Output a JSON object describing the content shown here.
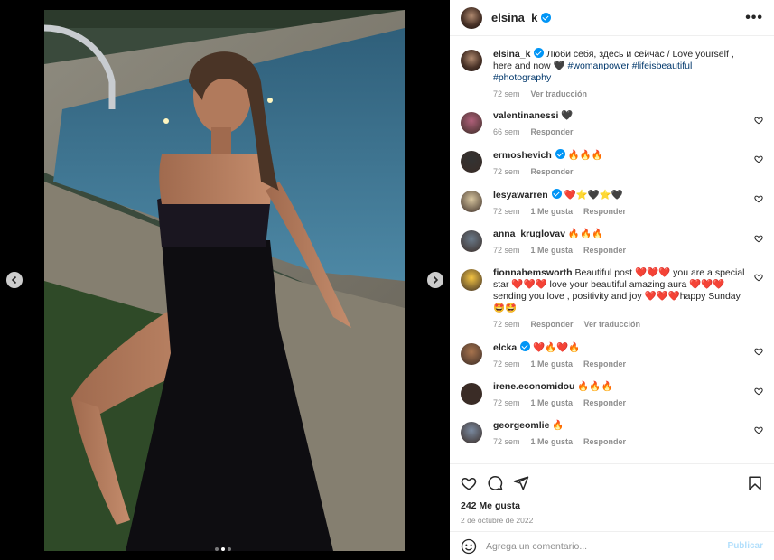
{
  "post": {
    "username": "elsina_k",
    "more_label": "•••",
    "caption_user": "elsina_k",
    "caption_text": "Люби себя, здесь и сейчас / Love yourself , here and now 🖤 ",
    "caption_tags": "#womanpower #lifeisbeautiful #photography",
    "caption_time": "72 sem",
    "caption_translate": "Ver traducción",
    "likes": "242 Me gusta",
    "date": "2 de octubre de 2022"
  },
  "comments": [
    {
      "user": "valentinanessi",
      "text": "🖤",
      "time": "66 sem",
      "likes": "",
      "reply": "Responder",
      "translate": "",
      "verified": false,
      "color": "#b0607a"
    },
    {
      "user": "ermoshevich",
      "text": "🔥🔥🔥",
      "time": "72 sem",
      "likes": "",
      "reply": "Responder",
      "translate": "",
      "verified": true,
      "color": "#333333"
    },
    {
      "user": "lesyawarren",
      "text": "❤️⭐🖤⭐🖤",
      "time": "72 sem",
      "likes": "1 Me gusta",
      "reply": "Responder",
      "translate": "",
      "verified": true,
      "color": "#d9c7a0"
    },
    {
      "user": "anna_kruglovav",
      "text": "🔥🔥🔥",
      "time": "72 sem",
      "likes": "1 Me gusta",
      "reply": "Responder",
      "translate": "",
      "verified": false,
      "color": "#6a7a8a"
    },
    {
      "user": "fionnahemsworth",
      "text": "Beautiful post ❤️❤️❤️ you are a special star ❤️❤️❤️ love your beautiful amazing aura ❤️❤️❤️ sending you love , positivity and joy ❤️❤️❤️happy Sunday 🤩🤩",
      "time": "72 sem",
      "likes": "",
      "reply": "Responder",
      "translate": "Ver traducción",
      "verified": false,
      "color": "#f5c542"
    },
    {
      "user": "elcka",
      "text": "❤️🔥❤️🔥",
      "time": "72 sem",
      "likes": "1 Me gusta",
      "reply": "Responder",
      "translate": "",
      "verified": true,
      "color": "#a8744e"
    },
    {
      "user": "irene.economidou",
      "text": "🔥🔥🔥",
      "time": "72 sem",
      "likes": "1 Me gusta",
      "reply": "Responder",
      "translate": "",
      "verified": false,
      "color": "#3a2c26"
    },
    {
      "user": "georgeomlie",
      "text": "🔥",
      "time": "72 sem",
      "likes": "1 Me gusta",
      "reply": "Responder",
      "translate": "",
      "verified": false,
      "color": "#7a8aa0"
    }
  ],
  "add_comment": {
    "placeholder": "Agrega un comentario...",
    "post_label": "Publicar"
  },
  "carousel": {
    "total": 3,
    "active": 2
  },
  "icons": {
    "like": "heart-icon",
    "comment": "comment-icon",
    "share": "share-icon",
    "save": "bookmark-icon",
    "emoji": "emoji-icon",
    "prev": "chevron-left-icon",
    "next": "chevron-right-icon"
  },
  "colors": {
    "verified": "#0095f6",
    "hashtag": "#00376b",
    "secondary": "#8e8e8e",
    "post_disabled": "#b2dffc"
  }
}
